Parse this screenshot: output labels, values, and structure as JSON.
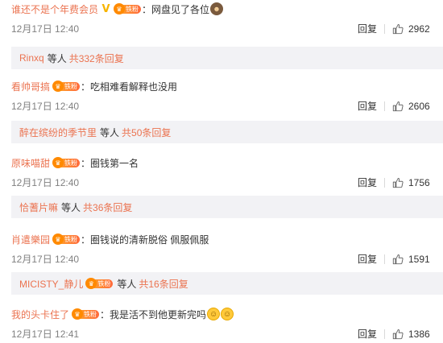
{
  "comments": [
    {
      "user": "谁还不是个年费会员",
      "text": "网盘见了各位",
      "time": "12月17日 12:40",
      "reply_label": "回复",
      "likes": "2962",
      "replies": {
        "users": "Rinxq",
        "etc": "等人",
        "total": "共332条回复"
      }
    },
    {
      "user": "看帅哥搞",
      "text": "吃相难看解释也没用",
      "time": "12月17日 12:40",
      "reply_label": "回复",
      "likes": "2606",
      "replies": {
        "users": "醉在缤纷的季节里",
        "etc": "等人",
        "total": "共50条回复"
      }
    },
    {
      "user": "原味喵甜",
      "text": "圈钱第一名",
      "time": "12月17日 12:40",
      "reply_label": "回复",
      "likes": "1756",
      "replies": {
        "users": "恰蓍片嘛",
        "etc": "等人",
        "total": "共36条回复"
      }
    },
    {
      "user": "肖遣樂园",
      "text": "圈钱说的清新脱俗 佩服佩服",
      "time": "12月17日 12:40",
      "reply_label": "回复",
      "likes": "1591",
      "replies": {
        "users": "MICISTY_静儿",
        "etc": "等人",
        "total": "共16条回复"
      }
    },
    {
      "user": "我的头卡住了",
      "text": "我是活不到他更新完吗",
      "time": "12月17日 12:41",
      "reply_label": "回复",
      "likes": "1386"
    }
  ],
  "common": {
    "colon": "：",
    "fan_label": "铁粉",
    "fan_crown": "♛",
    "vip_badge": "V",
    "emoji_meme": "☻",
    "emoji_smile": "☺"
  },
  "colors": {
    "username": "#eb7350",
    "replies_bg": "#f2f2f5",
    "fan_badge": "#ff8a00",
    "time": "#808080"
  },
  "icons": {
    "like": "thumbs-up-icon",
    "fan": "crown-icon",
    "vip": "v-badge-icon"
  }
}
